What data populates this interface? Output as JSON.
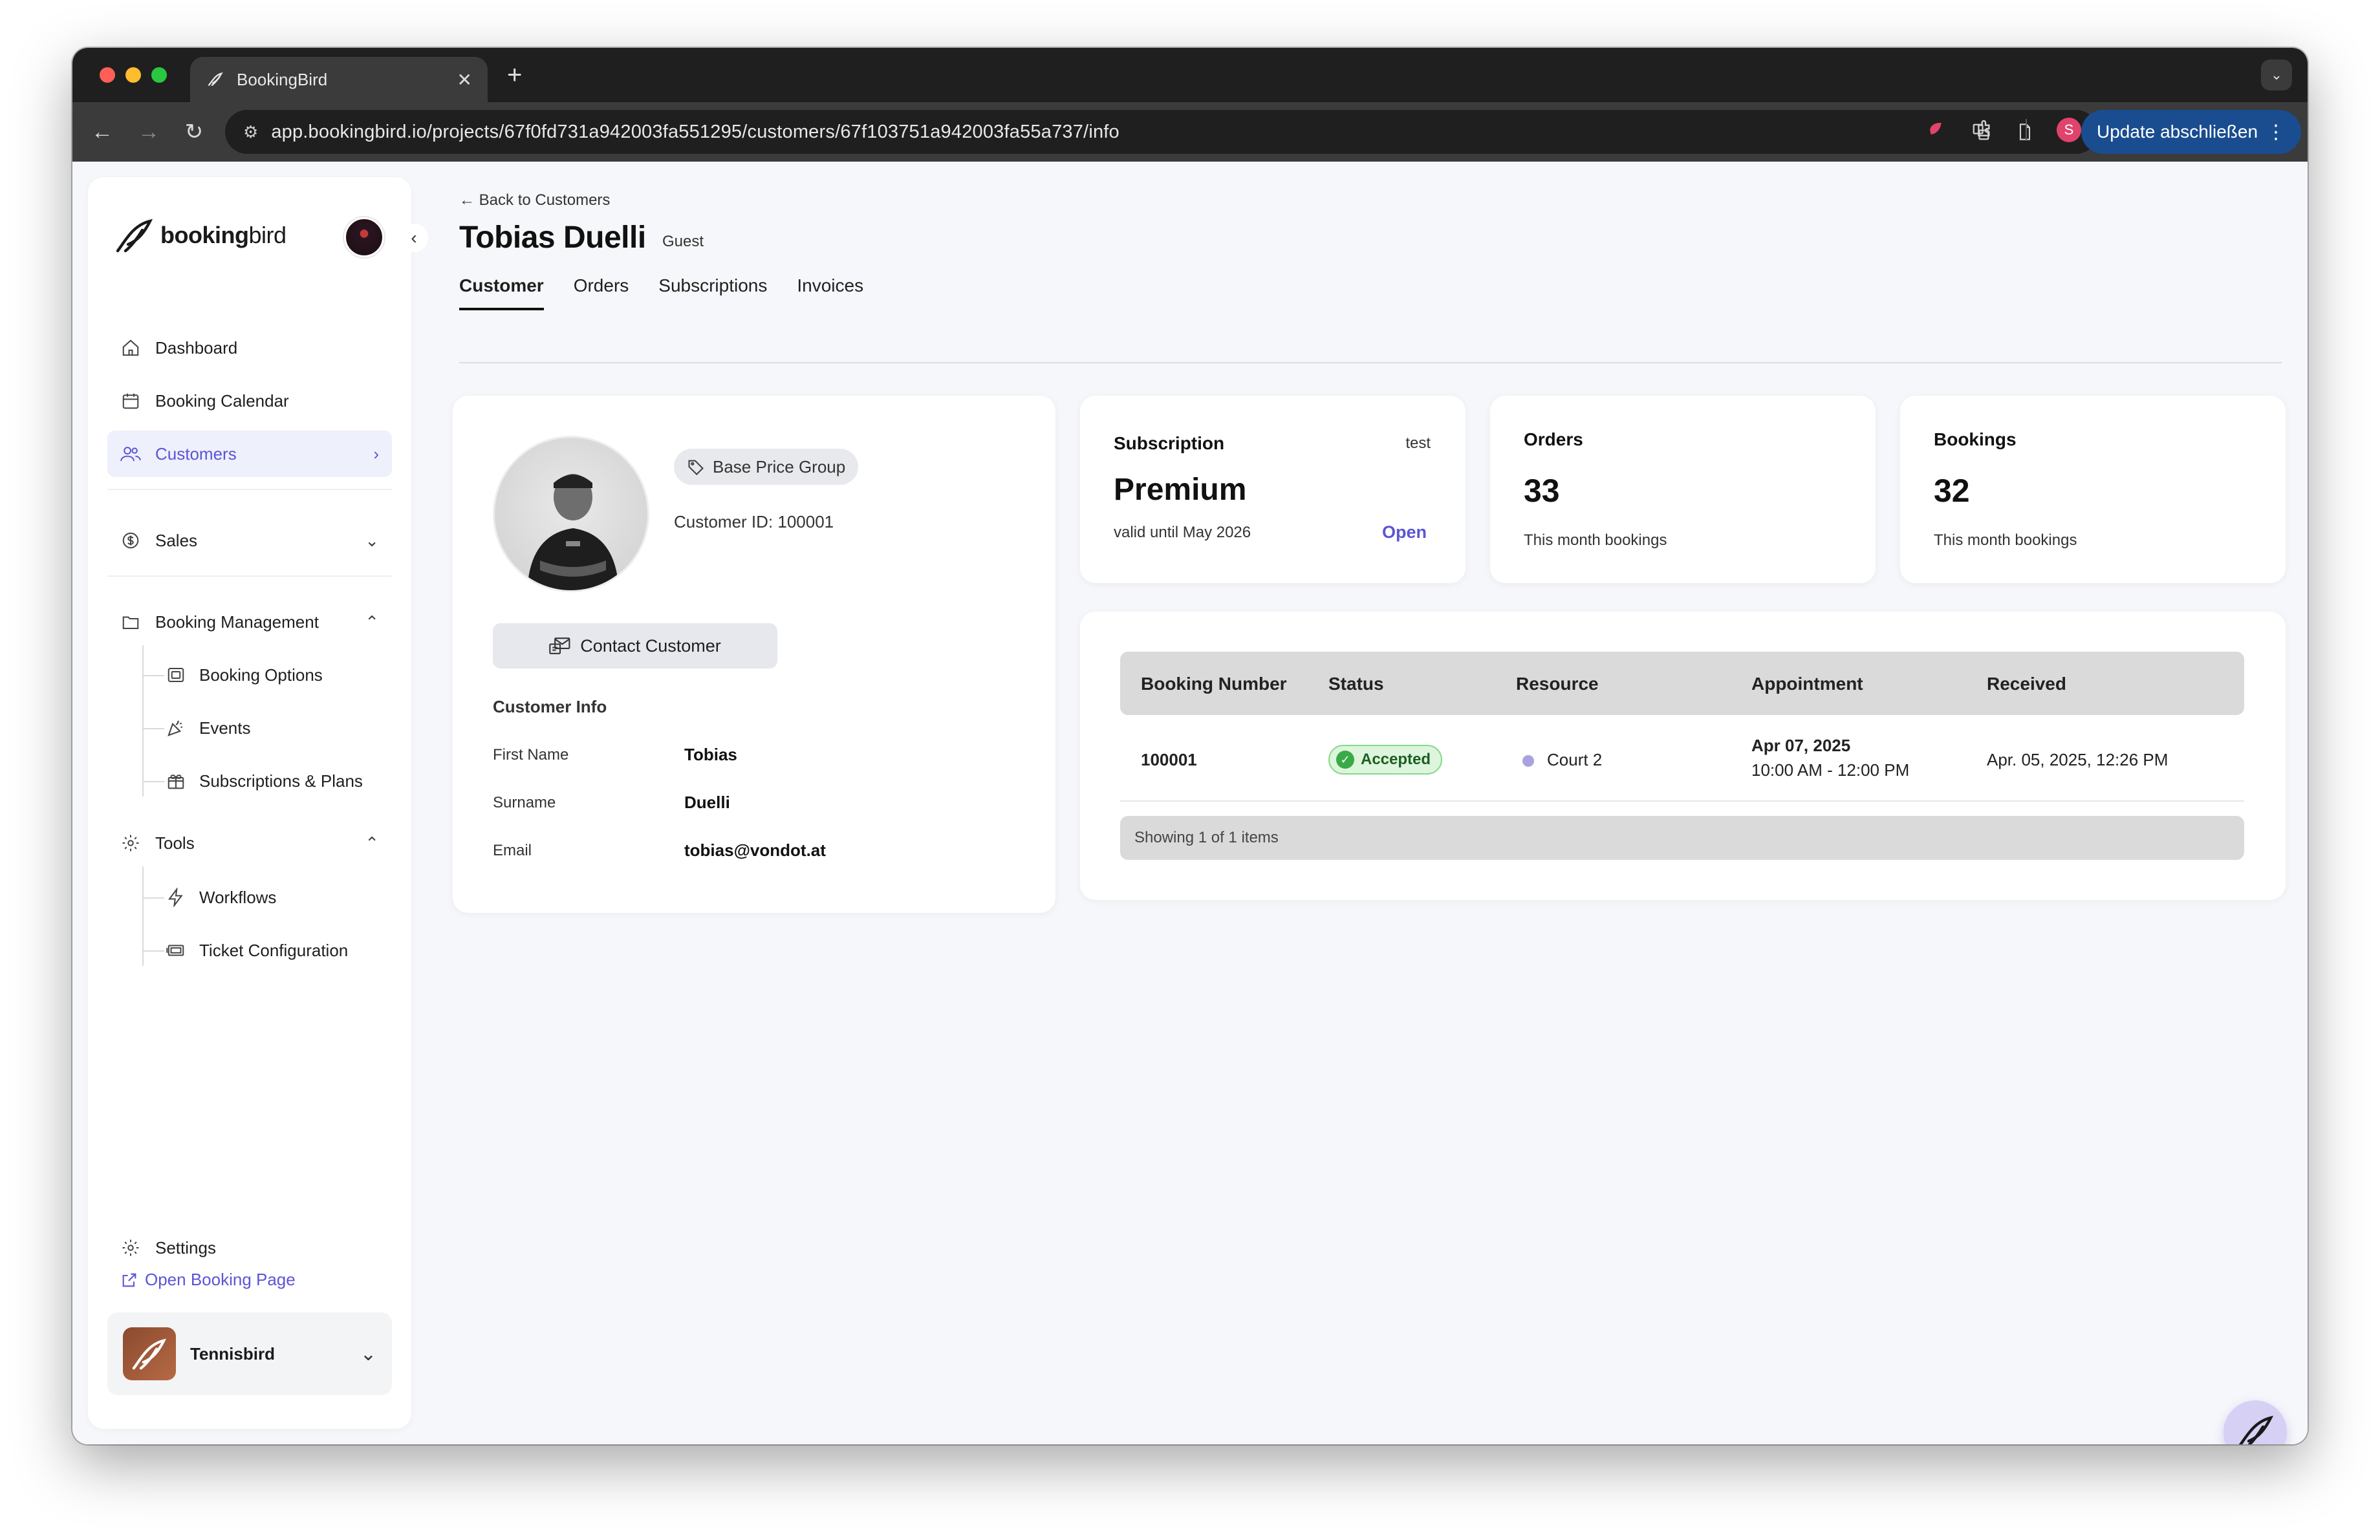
{
  "browser": {
    "tab_title": "BookingBird",
    "url": "app.bookingbird.io/projects/67f0fd731a942003fa551295/customers/67f103751a942003fa55a737/info",
    "update_label": "Update abschließen",
    "profile_initial": "S"
  },
  "sidebar": {
    "logo_bold": "booking",
    "logo_light": "bird",
    "nav": {
      "dashboard": "Dashboard",
      "booking_calendar": "Booking Calendar",
      "customers": "Customers",
      "sales": "Sales",
      "booking_management": "Booking Management",
      "booking_options": "Booking Options",
      "events": "Events",
      "subscriptions_plans": "Subscriptions & Plans",
      "tools": "Tools",
      "workflows": "Workflows",
      "ticket_configuration": "Ticket Configuration",
      "settings": "Settings",
      "open_booking_page": "Open Booking Page"
    },
    "workspace_name": "Tennisbird"
  },
  "header": {
    "back_link": "← Back to Customers",
    "title": "Tobias Duelli",
    "badge": "Guest",
    "tabs": [
      "Customer",
      "Orders",
      "Subscriptions",
      "Invoices"
    ]
  },
  "profile": {
    "price_group": "Base Price Group",
    "customer_id": "Customer ID: 100001",
    "contact_button": "Contact Customer",
    "info_title": "Customer Info",
    "fields": [
      {
        "label": "First Name",
        "value": "Tobias"
      },
      {
        "label": "Surname",
        "value": "Duelli"
      },
      {
        "label": "Email",
        "value": "tobias@vondot.at"
      }
    ]
  },
  "stats": {
    "subscription": {
      "title": "Subscription",
      "tag": "test",
      "plan": "Premium",
      "valid": "valid until May 2026",
      "action": "Open"
    },
    "orders": {
      "title": "Orders",
      "value": "33",
      "caption": "This month bookings"
    },
    "bookings": {
      "title": "Bookings",
      "value": "32",
      "caption": "This month bookings"
    }
  },
  "table": {
    "columns": [
      "Booking Number",
      "Status",
      "Resource",
      "Appointment",
      "Received"
    ],
    "rows": [
      {
        "booking_number": "100001",
        "status": "Accepted",
        "resource": "Court 2",
        "appointment_date": "Apr 07, 2025",
        "appointment_time": "10:00 AM - 12:00 PM",
        "received": "Apr. 05, 2025, 12:26 PM"
      }
    ],
    "footer": "Showing 1 of 1 items"
  },
  "colors": {
    "accent": "#5b55d6",
    "status_green": "#3aaa48",
    "resource_dot": "#a9a2e0"
  }
}
